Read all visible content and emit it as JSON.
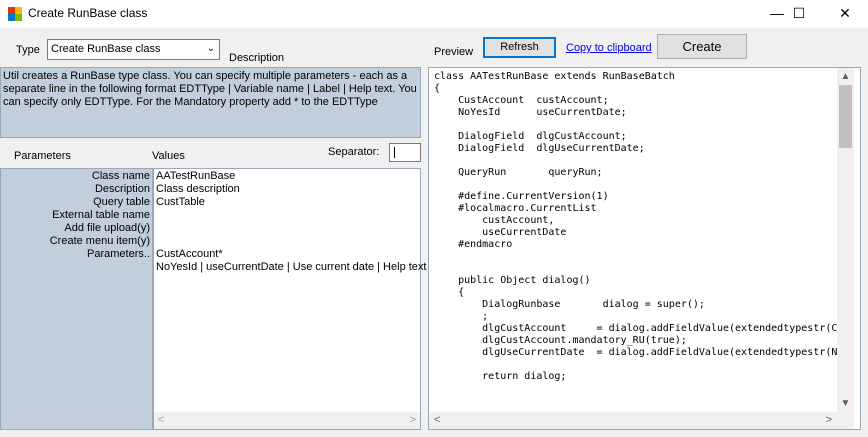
{
  "window": {
    "title": "Create RunBase class",
    "minimize_glyph": "—",
    "maximize_glyph": "☐",
    "close_glyph": "✕",
    "app_icon": "runbase-app-icon"
  },
  "toolbar": {
    "type_label": "Type",
    "type_value": "Create RunBase class",
    "description_label": "Description",
    "preview_label": "Preview",
    "refresh_label": "Refresh",
    "clipboard_label": "Copy to clipboard",
    "create_label": "Create"
  },
  "description_text": "Util creates a RunBase type class. You can specify multiple parameters - each as a separate line in the following format EDTType | Variable name | Label | Help text. You can specify only EDTType. For the Mandatory property add * to the EDTType",
  "params_header": {
    "parameters_label": "Parameters",
    "values_label": "Values",
    "separator_label": "Separator:",
    "separator_value": ""
  },
  "params": [
    {
      "name": "Class name",
      "value": "AATestRunBase"
    },
    {
      "name": "Description",
      "value": "Class description"
    },
    {
      "name": "Query table",
      "value": "CustTable"
    },
    {
      "name": "External table name",
      "value": ""
    },
    {
      "name": "Add file upload(y)",
      "value": ""
    },
    {
      "name": "Create menu item(y)",
      "value": ""
    },
    {
      "name": "Parameters..",
      "value": "CustAccount*"
    }
  ],
  "params_extra_line": "NoYesId | useCurrentDate | Use current date | Help text",
  "code": "class AATestRunBase extends RunBaseBatch\n{\n    CustAccount  custAccount;\n    NoYesId      useCurrentDate;\n\n    DialogField  dlgCustAccount;\n    DialogField  dlgUseCurrentDate;\n\n    QueryRun       queryRun;\n\n    #define.CurrentVersion(1)\n    #localmacro.CurrentList\n        custAccount,\n        useCurrentDate\n    #endmacro\n\n\n    public Object dialog()\n    {\n        DialogRunbase       dialog = super();\n        ;\n        dlgCustAccount     = dialog.addFieldValue(extendedtypestr(C\n        dlgCustAccount.mandatory_RU(true);\n        dlgUseCurrentDate  = dialog.addFieldValue(extendedtypestr(N\n\n        return dialog;",
  "colors": {
    "panel_blue": "#c2cedb",
    "focus_border": "#0078d7",
    "link": "#0000ee"
  }
}
